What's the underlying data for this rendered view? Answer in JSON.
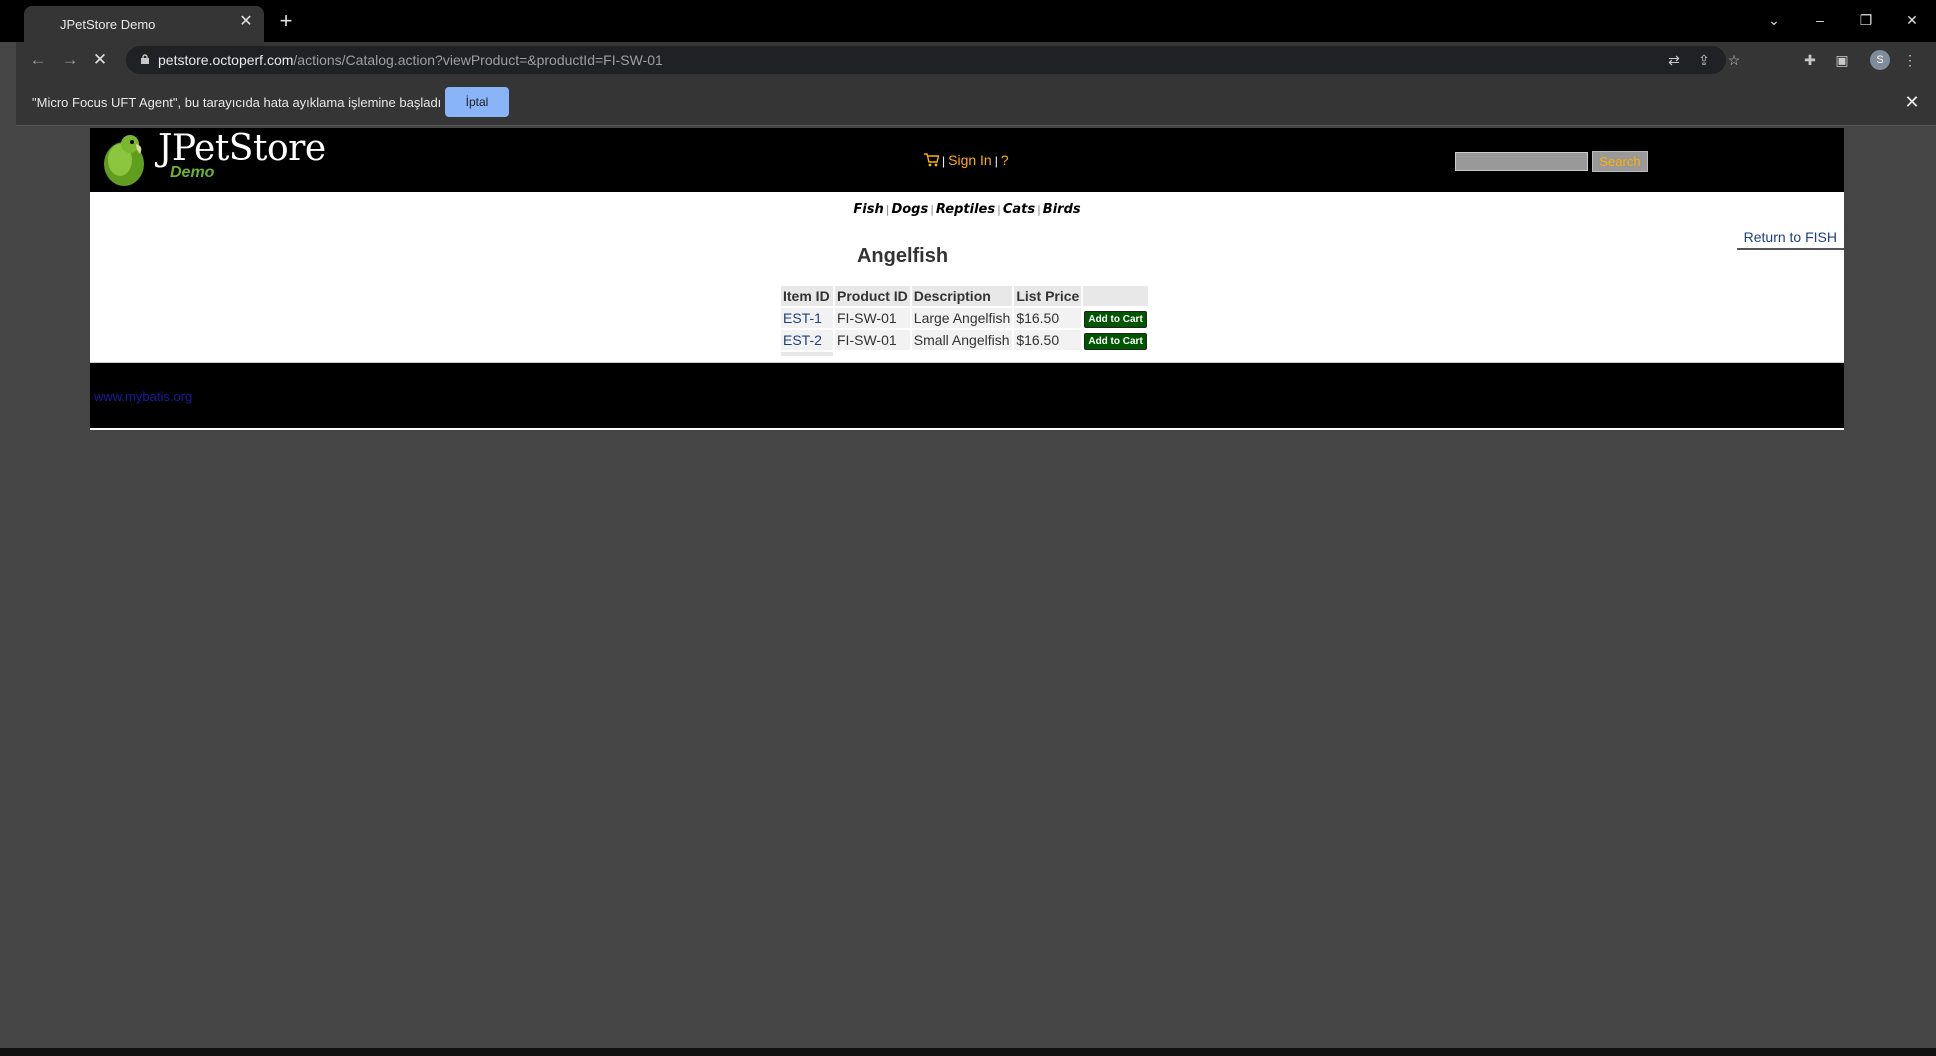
{
  "browser": {
    "tab_title": "JPetStore Demo",
    "url_host": "petstore.octoperf.com",
    "url_path": "/actions/Catalog.action?viewProduct=&productId=FI-SW-01",
    "profile_initial": "S"
  },
  "infobar": {
    "message": "\"Micro Focus UFT Agent\", bu tarayıcıda hata ayıklama işlemine başladı",
    "cancel_label": "İptal"
  },
  "header": {
    "logo_title": "JPetStore",
    "logo_subtitle": "Demo",
    "sign_in": "Sign In",
    "help": "?",
    "search_button": "Search",
    "search_value": ""
  },
  "categories": [
    "Fish",
    "Dogs",
    "Reptiles",
    "Cats",
    "Birds"
  ],
  "product": {
    "name": "Angelfish",
    "return_link": "Return to FISH",
    "columns": [
      "Item ID",
      "Product ID",
      "Description",
      "List Price",
      ""
    ],
    "rows": [
      {
        "item_id": "EST-1",
        "product_id": "FI-SW-01",
        "description": "Large Angelfish",
        "price": "$16.50",
        "action": "Add to Cart"
      },
      {
        "item_id": "EST-2",
        "product_id": "FI-SW-01",
        "description": "Small Angelfish",
        "price": "$16.50",
        "action": "Add to Cart"
      }
    ]
  },
  "footer": {
    "link": "www.mybatis.org"
  },
  "colors": {
    "accent_orange": "#ffb000",
    "cart_button_green": "#005500",
    "logo_green": "#6cb22e"
  }
}
